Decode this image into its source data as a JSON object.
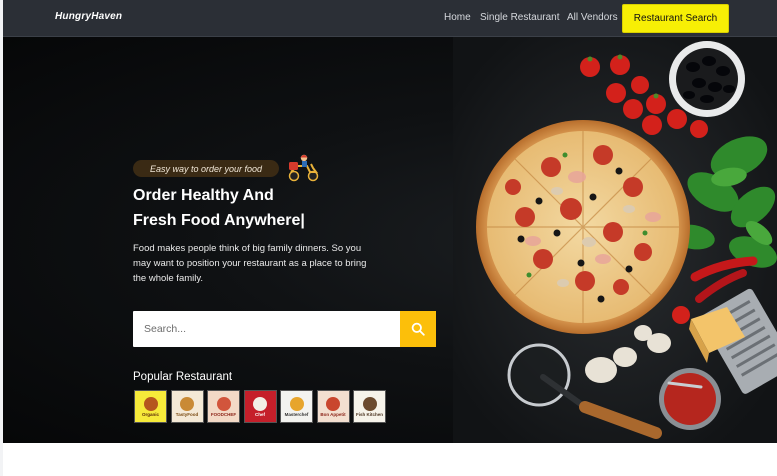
{
  "navbar": {
    "brand": "HungryHaven",
    "links": [
      "Home",
      "Single Restaurant",
      "All Vendors"
    ],
    "cta": "Restaurant Search"
  },
  "hero": {
    "tagline": "Easy way to order your food",
    "title_line1": "Order Healthy And",
    "title_line2": "Fresh Food Anywhere|",
    "description": "Food makes people think of big family dinners. So you may want to position your restaurant as a place to bring the whole family.",
    "search": {
      "placeholder": "Search...",
      "value": ""
    },
    "popular_title": "Popular Restaurant",
    "restaurants": [
      {
        "name": "Organic",
        "bg": "#f6ea3a",
        "mark": "#b5561e",
        "color": "#5a2a0a"
      },
      {
        "name": "TastyFood",
        "bg": "#f4e9d6",
        "mark": "#c98a35",
        "color": "#7a4a12"
      },
      {
        "name": "FOODCHEF",
        "bg": "#f3d9c6",
        "mark": "#d2553c",
        "color": "#8c2418"
      },
      {
        "name": "Chef",
        "bg": "#c51f2a",
        "mark": "#f2efe6",
        "color": "#ffffff"
      },
      {
        "name": "Masterchef",
        "bg": "#f3f3f0",
        "mark": "#e7a52c",
        "color": "#333333"
      },
      {
        "name": "Bon Appetit",
        "bg": "#f3dfd0",
        "mark": "#c9462e",
        "color": "#8c2418"
      },
      {
        "name": "Fish Kitchen",
        "bg": "#f6f3ea",
        "mark": "#6b4a2e",
        "color": "#4a3320"
      }
    ]
  }
}
